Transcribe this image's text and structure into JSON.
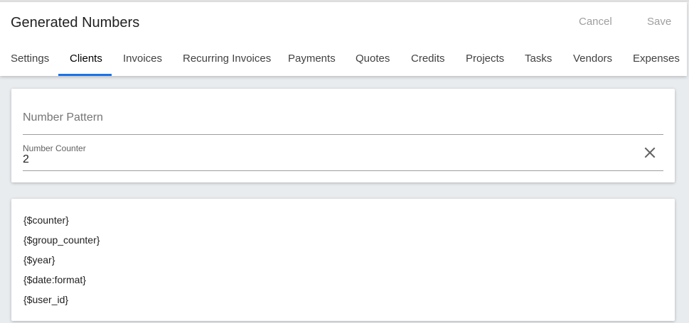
{
  "header": {
    "title": "Generated Numbers",
    "cancel_label": "Cancel",
    "save_label": "Save"
  },
  "tabs": [
    {
      "label": "Settings"
    },
    {
      "label": "Clients"
    },
    {
      "label": "Invoices"
    },
    {
      "label": "Recurring Invoices"
    },
    {
      "label": "Payments"
    },
    {
      "label": "Quotes"
    },
    {
      "label": "Credits"
    },
    {
      "label": "Projects"
    },
    {
      "label": "Tasks"
    },
    {
      "label": "Vendors"
    },
    {
      "label": "Expenses"
    }
  ],
  "active_tab": "Clients",
  "form": {
    "number_pattern_placeholder": "Number Pattern",
    "number_pattern_value": "",
    "number_counter_label": "Number Counter",
    "number_counter_value": "2"
  },
  "variables": [
    "{$counter}",
    "{$group_counter}",
    "{$year}",
    "{$date:format}",
    "{$user_id}"
  ],
  "colors": {
    "accent": "#1a73e8",
    "background": "#e9ecef",
    "muted_action": "#9e9e9e"
  },
  "icons": {
    "clear": "close-icon"
  }
}
